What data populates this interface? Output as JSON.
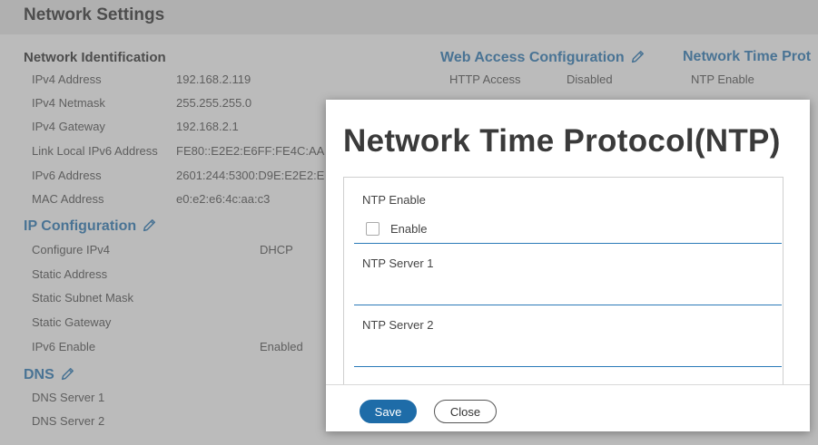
{
  "page": {
    "title": "Network Settings"
  },
  "network_identification": {
    "title": "Network Identification",
    "rows": [
      {
        "label": "IPv4 Address",
        "value": "192.168.2.119"
      },
      {
        "label": "IPv4 Netmask",
        "value": "255.255.255.0"
      },
      {
        "label": "IPv4 Gateway",
        "value": "192.168.2.1"
      },
      {
        "label": "Link Local IPv6 Address",
        "value": "FE80::E2E2:E6FF:FE4C:AA"
      },
      {
        "label": "IPv6 Address",
        "value": "2601:244:5300:D9E:E2E2:E"
      },
      {
        "label": "MAC Address",
        "value": "e0:e2:e6:4c:aa:c3"
      }
    ]
  },
  "ip_configuration": {
    "title": "IP Configuration",
    "rows": [
      {
        "label": "Configure IPv4",
        "value": "DHCP"
      },
      {
        "label": "Static Address",
        "value": ""
      },
      {
        "label": "Static Subnet Mask",
        "value": ""
      },
      {
        "label": "Static Gateway",
        "value": ""
      },
      {
        "label": "IPv6 Enable",
        "value": "Enabled"
      }
    ]
  },
  "dns": {
    "title": "DNS",
    "rows": [
      {
        "label": "DNS Server 1"
      },
      {
        "label": "DNS Server 2"
      }
    ]
  },
  "web_access": {
    "title": "Web Access Configuration",
    "rows": [
      {
        "label": "HTTP Access",
        "value": "Disabled"
      }
    ]
  },
  "ntp_section": {
    "title": "Network Time Prot",
    "rows": [
      {
        "label": "NTP Enable"
      }
    ]
  },
  "modal": {
    "title": "Network Time Protocol(NTP)",
    "ntp_enable_label": "NTP Enable",
    "enable_checkbox_label": "Enable",
    "ntp_server_1_label": "NTP Server 1",
    "ntp_server_1_value": "",
    "ntp_server_2_label": "NTP Server 2",
    "ntp_server_2_value": "",
    "save_label": "Save",
    "close_label": "Close"
  },
  "colors": {
    "accent_blue": "#1a6fb0",
    "save_button": "#1e6ca8",
    "field_underline": "#2a7ab8",
    "header_bg": "#e8e8e8"
  },
  "icons": [
    "pencil-icon"
  ]
}
